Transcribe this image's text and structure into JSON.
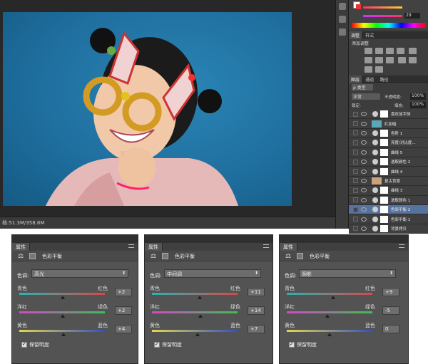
{
  "status": {
    "doc_size": "档:51.3M/358.8M"
  },
  "panels_top": {
    "color_tabs": [
      "调整",
      "样式"
    ],
    "add_adjust": "添加调整",
    "layer_tabs": [
      "图层",
      "通道",
      "路径"
    ],
    "filter_kind": "ρ 类型",
    "blend_mode": "正常",
    "opacity_label": "不透明度:",
    "opacity_val": "100%",
    "lock_label": "锁定:",
    "fill_label": "填充:",
    "fill_val": "100%",
    "color_val": "29",
    "layers": [
      {
        "name": "喜欢加字体"
      },
      {
        "name": "红加暗"
      },
      {
        "name": "色阶 1"
      },
      {
        "name": "亮度/对比度..."
      },
      {
        "name": "曲线 5"
      },
      {
        "name": "选取颜色 2"
      },
      {
        "name": "曲线 4"
      },
      {
        "name": "复古背景"
      },
      {
        "name": "曲线 3"
      },
      {
        "name": "选取颜色 1"
      },
      {
        "name": "色彩平衡 2"
      },
      {
        "name": "色彩平衡 1"
      },
      {
        "name": "背景拷贝"
      }
    ]
  },
  "props": [
    {
      "tab": "属性",
      "title": "色彩平衡",
      "tone_label": "色调:",
      "tone": "高光",
      "sliders": [
        {
          "left": "青色",
          "right": "红色",
          "value": "+2",
          "pos": 0.51
        },
        {
          "left": "洋红",
          "right": "绿色",
          "value": "+2",
          "pos": 0.51
        },
        {
          "left": "黄色",
          "right": "蓝色",
          "value": "+4",
          "pos": 0.52
        }
      ],
      "preserve": "保留明度"
    },
    {
      "tab": "属性",
      "title": "色彩平衡",
      "tone_label": "色调:",
      "tone": "中间调",
      "sliders": [
        {
          "left": "青色",
          "right": "红色",
          "value": "+11",
          "pos": 0.555
        },
        {
          "left": "洋红",
          "right": "绿色",
          "value": "+14",
          "pos": 0.57
        },
        {
          "left": "黄色",
          "right": "蓝色",
          "value": "+7",
          "pos": 0.535
        }
      ],
      "preserve": "保留明度"
    },
    {
      "tab": "属性",
      "title": "色彩平衡",
      "tone_label": "色调:",
      "tone": "阴影",
      "sliders": [
        {
          "left": "青色",
          "right": "红色",
          "value": "+9",
          "pos": 0.545
        },
        {
          "left": "洋红",
          "right": "绿色",
          "value": "-5",
          "pos": 0.475
        },
        {
          "left": "黄色",
          "right": "蓝色",
          "value": "0",
          "pos": 0.5
        }
      ],
      "preserve": "保留明度"
    }
  ]
}
